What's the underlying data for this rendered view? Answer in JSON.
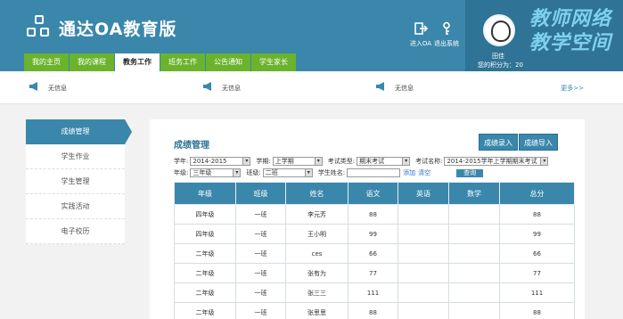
{
  "app": {
    "title": "通达OA教育版"
  },
  "header": {
    "login_label": "进入OA",
    "logout_label": "退出系统",
    "user_name": "田佳",
    "user_points": "您的积分为：20",
    "watermark_line1": "教师网络",
    "watermark_line2": "教学空间"
  },
  "nav": [
    "我的主页",
    "我的课程",
    "教务工作",
    "班务工作",
    "公告通知",
    "学生家长"
  ],
  "notices": [
    "无信息",
    "无信息",
    "无信息"
  ],
  "more_label": "更多>>",
  "sidebar": [
    "成绩管理",
    "学生作业",
    "学生管理",
    "实践活动",
    "电子校历"
  ],
  "main": {
    "title": "成绩管理",
    "btn_import_score": "成绩录入",
    "btn_import_file": "成绩导入"
  },
  "filters": {
    "year_label": "学年:",
    "year_value": "2014-2015",
    "term_label": "学期:",
    "term_value": "上学期",
    "exam_type_label": "考试类型:",
    "exam_type_value": "期末考试",
    "exam_name_label": "考试名称:",
    "exam_name_value": "2014-2015学年上学期期末考试",
    "grade_label": "年级:",
    "grade_value": "三年级",
    "class_label": "班级:",
    "class_value": "二班",
    "student_label": "学生姓名:",
    "add_label": "添加",
    "clear_label": "清空",
    "query_label": "查询"
  },
  "table": {
    "headers": [
      "年级",
      "班级",
      "姓名",
      "语文",
      "英语",
      "数学",
      "总分"
    ],
    "rows": [
      [
        "四年级",
        "一班",
        "李元芳",
        "88",
        "",
        "",
        "88"
      ],
      [
        "四年级",
        "一班",
        "王小明",
        "99",
        "",
        "",
        "99"
      ],
      [
        "二年级",
        "一班",
        "ces",
        "66",
        "",
        "",
        "66"
      ],
      [
        "二年级",
        "一班",
        "张有为",
        "77",
        "",
        "",
        "77"
      ],
      [
        "二年级",
        "一班",
        "张三三",
        "111",
        "",
        "",
        "111"
      ],
      [
        "二年级",
        "一班",
        "张思思",
        "88",
        "",
        "",
        "88"
      ]
    ]
  }
}
